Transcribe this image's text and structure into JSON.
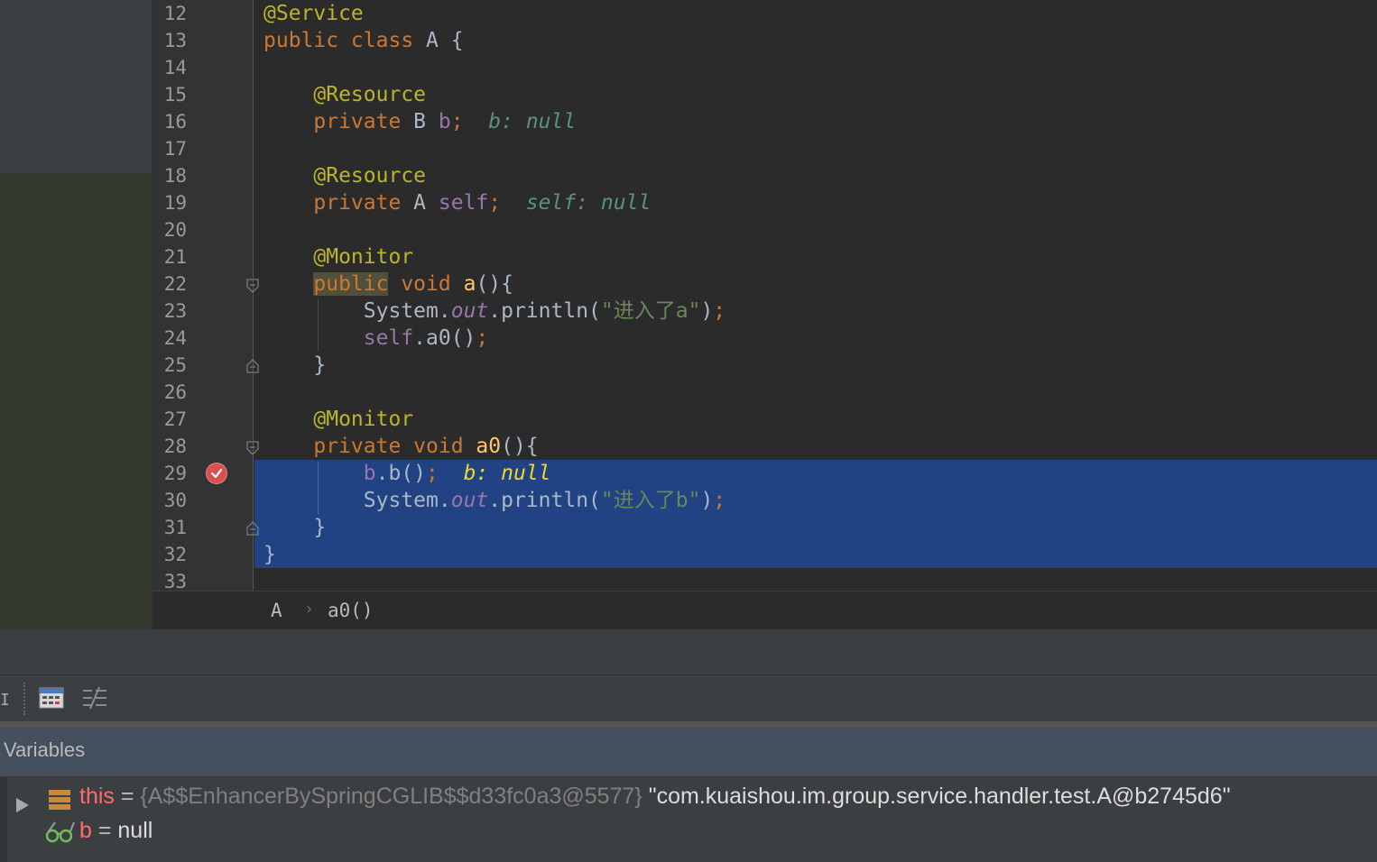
{
  "editor": {
    "lines": [
      {
        "num": "12",
        "tokens": [
          {
            "t": "@Service",
            "c": "ann"
          }
        ]
      },
      {
        "num": "13",
        "tokens": [
          {
            "t": "public class ",
            "c": "kw"
          },
          {
            "t": "A {",
            "c": "plain"
          }
        ]
      },
      {
        "num": "14",
        "tokens": []
      },
      {
        "num": "15",
        "tokens": [
          {
            "t": "    ",
            "c": "plain"
          },
          {
            "t": "@Resource",
            "c": "ann"
          }
        ]
      },
      {
        "num": "16",
        "tokens": [
          {
            "t": "    ",
            "c": "plain"
          },
          {
            "t": "private ",
            "c": "kw"
          },
          {
            "t": "B ",
            "c": "plain"
          },
          {
            "t": "b",
            "c": "field"
          },
          {
            "t": ";",
            "c": "punct"
          },
          {
            "t": "  b: null",
            "c": "hint"
          }
        ]
      },
      {
        "num": "17",
        "tokens": []
      },
      {
        "num": "18",
        "tokens": [
          {
            "t": "    ",
            "c": "plain"
          },
          {
            "t": "@Resource",
            "c": "ann"
          }
        ]
      },
      {
        "num": "19",
        "tokens": [
          {
            "t": "    ",
            "c": "plain"
          },
          {
            "t": "private ",
            "c": "kw"
          },
          {
            "t": "A ",
            "c": "plain"
          },
          {
            "t": "self",
            "c": "field"
          },
          {
            "t": ";",
            "c": "punct"
          },
          {
            "t": "  self: null",
            "c": "hint"
          }
        ]
      },
      {
        "num": "20",
        "tokens": []
      },
      {
        "num": "21",
        "tokens": [
          {
            "t": "    ",
            "c": "plain"
          },
          {
            "t": "@Monitor",
            "c": "ann"
          }
        ]
      },
      {
        "num": "22",
        "tokens": [
          {
            "t": "    ",
            "c": "plain"
          },
          {
            "t": "public",
            "c": "kw kw-hl"
          },
          {
            "t": " void ",
            "c": "kw"
          },
          {
            "t": "a",
            "c": "fn"
          },
          {
            "t": "(){",
            "c": "plain"
          }
        ]
      },
      {
        "num": "23",
        "tokens": [
          {
            "t": "        System.",
            "c": "plain"
          },
          {
            "t": "out",
            "c": "field italic"
          },
          {
            "t": ".println(",
            "c": "plain"
          },
          {
            "t": "\"进入了a\"",
            "c": "str"
          },
          {
            "t": ")",
            "c": "plain"
          },
          {
            "t": ";",
            "c": "punct"
          }
        ]
      },
      {
        "num": "24",
        "tokens": [
          {
            "t": "        ",
            "c": "plain"
          },
          {
            "t": "self",
            "c": "field"
          },
          {
            "t": ".a0()",
            "c": "plain"
          },
          {
            "t": ";",
            "c": "punct"
          }
        ]
      },
      {
        "num": "25",
        "tokens": [
          {
            "t": "    }",
            "c": "plain"
          }
        ]
      },
      {
        "num": "26",
        "tokens": []
      },
      {
        "num": "27",
        "tokens": [
          {
            "t": "    ",
            "c": "plain"
          },
          {
            "t": "@Monitor",
            "c": "ann"
          }
        ]
      },
      {
        "num": "28",
        "tokens": [
          {
            "t": "    ",
            "c": "plain"
          },
          {
            "t": "private void ",
            "c": "kw"
          },
          {
            "t": "a0",
            "c": "fn"
          },
          {
            "t": "(){",
            "c": "plain"
          }
        ]
      },
      {
        "num": "29",
        "tokens": [
          {
            "t": "        ",
            "c": "plain"
          },
          {
            "t": "b",
            "c": "field"
          },
          {
            "t": ".b()",
            "c": "plain"
          },
          {
            "t": ";",
            "c": "punct"
          },
          {
            "t": "  b: null",
            "c": "hint-sel"
          }
        ]
      },
      {
        "num": "30",
        "tokens": [
          {
            "t": "        System.",
            "c": "plain"
          },
          {
            "t": "out",
            "c": "field italic"
          },
          {
            "t": ".println(",
            "c": "plain"
          },
          {
            "t": "\"进入了b\"",
            "c": "str"
          },
          {
            "t": ")",
            "c": "plain"
          },
          {
            "t": ";",
            "c": "punct"
          }
        ]
      },
      {
        "num": "31",
        "tokens": [
          {
            "t": "    }",
            "c": "plain"
          }
        ]
      },
      {
        "num": "32",
        "tokens": [
          {
            "t": "}",
            "c": "plain"
          }
        ]
      },
      {
        "num": "33",
        "tokens": []
      }
    ]
  },
  "breadcrumb": {
    "items": [
      "A",
      "a0()"
    ],
    "separator": "›"
  },
  "toolbar": {
    "edge_glyph": "I",
    "icons": [
      "calculator-icon",
      "settings-list-icon"
    ]
  },
  "variables": {
    "title": "Variables",
    "rows": [
      {
        "icon": "object-icon",
        "expandable": true,
        "name": "this",
        "eq": " = ",
        "type": "{A$$EnhancerBySpringCGLIB$$d33fc0a3@5577}",
        "value": " \"com.kuaishou.im.group.service.handler.test.A@b2745d6\""
      },
      {
        "icon": "watch-glasses-icon",
        "expandable": false,
        "name": "b",
        "eq": " = ",
        "type": "",
        "value": "null"
      }
    ]
  },
  "colors": {
    "selection": "#214283",
    "keyword": "#cc7832",
    "annotation": "#bbb529",
    "field": "#9876aa",
    "string": "#6a8759",
    "breakpoint": "#d9504e"
  }
}
